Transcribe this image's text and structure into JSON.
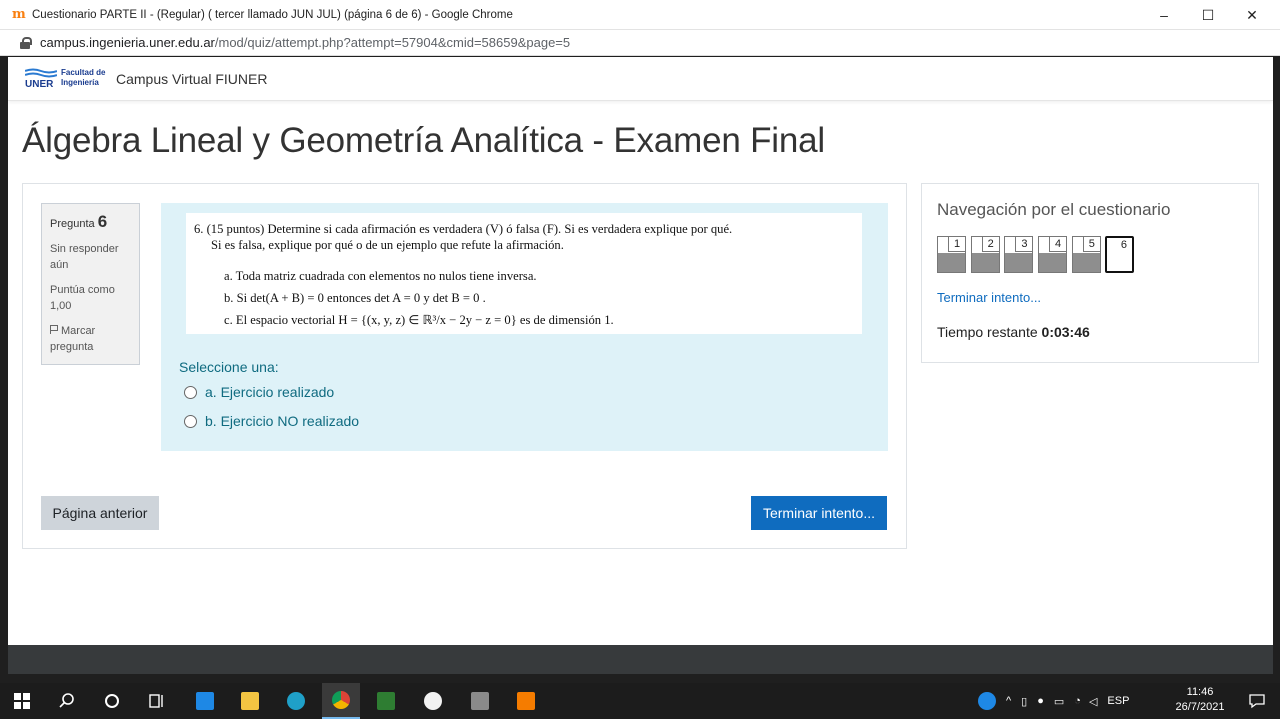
{
  "browser": {
    "tab_title": "Cuestionario PARTE II - (Regular) ( tercer llamado JUN JUL) (página 6 de 6) - Google Chrome",
    "url_host": "campus.ingenieria.uner.edu.ar",
    "url_path": "/mod/quiz/attempt.php?attempt=57904&cmid=58659&page=5",
    "minimize": "–",
    "maximize": "☐",
    "close": "✕"
  },
  "site": {
    "logo_text": "UNER",
    "logo_sub": "Facultad de Ingeniería",
    "name": "Campus Virtual FIUNER"
  },
  "page_title": "Álgebra Lineal y Geometría Analítica - Examen Final",
  "question": {
    "label": "Pregunta",
    "number": "6",
    "status": "Sin responder aún",
    "score": "Puntúa como 1,00",
    "flag": "Marcar pregunta",
    "text_line1": "6.  (15 puntos)   Determine si cada afirmación es verdadera (V) ó falsa (F). Si es verdadera explique por qué.",
    "text_line2": "Si es falsa, explique por qué o de un ejemplo que refute la afirmación.",
    "item_a": "a.  Toda matriz cuadrada con elementos no nulos tiene inversa.",
    "item_b": "b.  Si det(A + B) = 0 entonces det A = 0 y det B = 0 .",
    "item_c": "c.  El espacio vectorial H = {(x, y, z) ∈ ℝ³/x − 2y − z = 0} es de dimensión 1.",
    "select_label": "Seleccione una:",
    "options": [
      "a. Ejercicio realizado",
      "b. Ejercicio NO realizado"
    ]
  },
  "buttons": {
    "prev": "Página anterior",
    "finish": "Terminar intento..."
  },
  "nav": {
    "title": "Navegación por el cuestionario",
    "questions": [
      "1",
      "2",
      "3",
      "4",
      "5",
      "6"
    ],
    "current": "6",
    "finish_link": "Terminar intento...",
    "time_label": "Tiempo restante",
    "time_value": "0:03:46"
  },
  "taskbar": {
    "lang": "ESP",
    "time": "11:46",
    "date": "26/7/2021"
  },
  "colors": {
    "accent": "#0f6cbf",
    "question_bg": "#def2f8",
    "info_bg": "#f1f1f1",
    "footer": "#373a3c"
  }
}
